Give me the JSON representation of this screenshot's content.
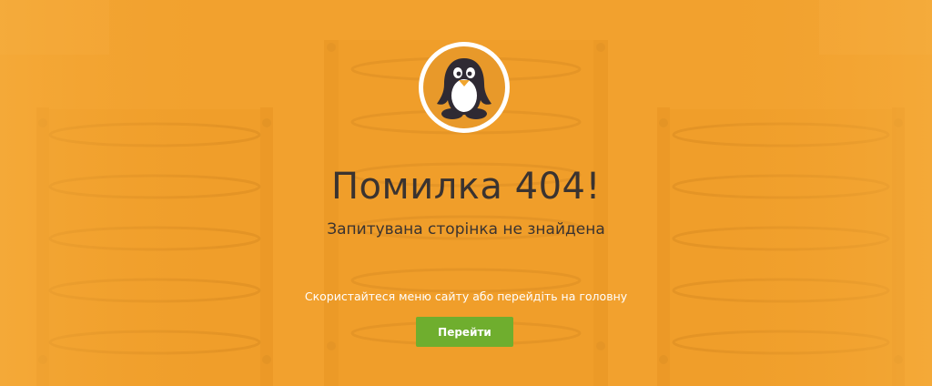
{
  "error_page": {
    "title": "Помилка 404!",
    "subtitle": "Запитувана сторінка не знайдена",
    "hint": "Скористайтеся меню сайту або перейдіть на головну",
    "button_label": "Перейти"
  },
  "icons": {
    "logo": "penguin-icon"
  },
  "colors": {
    "background": "#f2a12e",
    "button": "#6fae2e",
    "text_dark": "#3a3330",
    "text_light": "#ffffff",
    "logo_circle": "#e59a2a"
  }
}
